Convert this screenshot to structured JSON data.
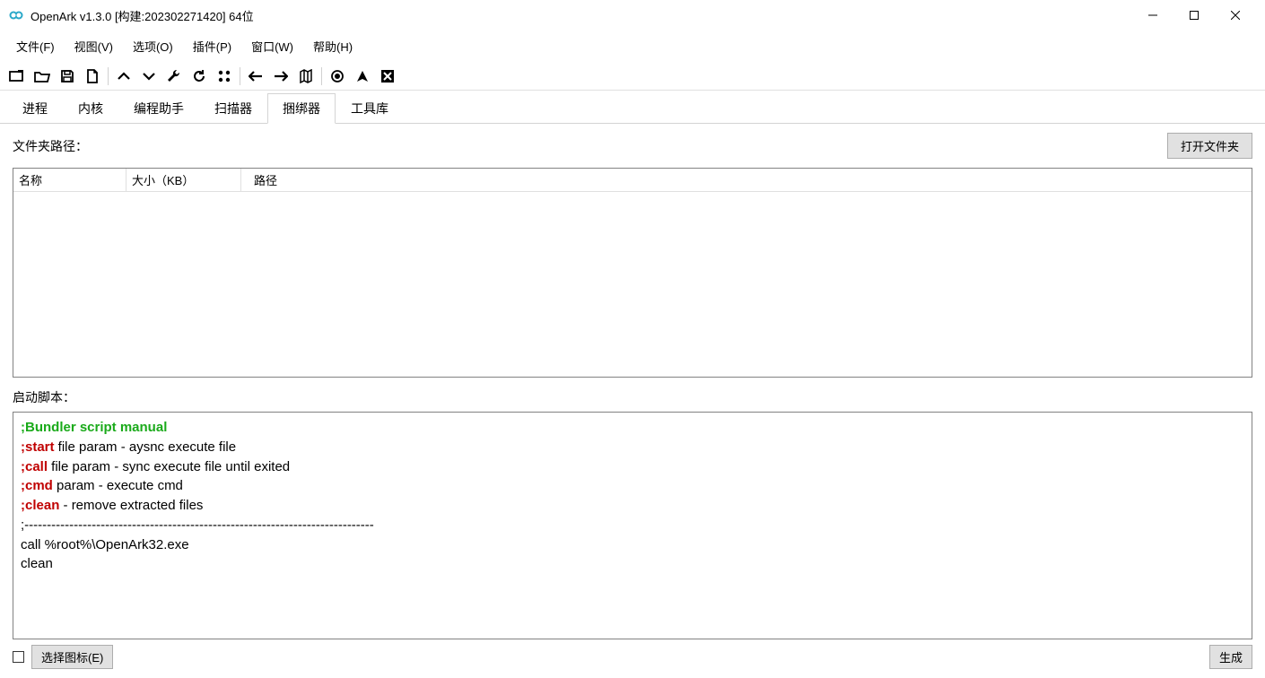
{
  "window": {
    "title": "OpenArk v1.3.0 [构建:202302271420]  64位"
  },
  "menu": {
    "file": "文件(F)",
    "view": "视图(V)",
    "options": "选项(O)",
    "plugin": "插件(P)",
    "window": "窗口(W)",
    "help": "帮助(H)"
  },
  "tabs": {
    "process": "进程",
    "kernel": "内核",
    "helper": "编程助手",
    "scanner": "扫描器",
    "bundler": "捆绑器",
    "toolkits": "工具库"
  },
  "bundler": {
    "folder_label": "文件夹路径：",
    "open_folder": "打开文件夹",
    "col_name": "名称",
    "col_size": "大小（KB）",
    "col_path": "路径",
    "script_label": "启动脚本：",
    "script": {
      "line1_comment": ";Bundler script manual",
      "line2_key": ";start",
      "line2_rest": " file param - aysnc execute file",
      "line3_key": ";call",
      "line3_rest": " file param - sync execute file until exited",
      "line4_key": ";cmd",
      "line4_rest": " param - execute cmd",
      "line5_key": ";clean",
      "line5_rest": " - remove extracted files",
      "line6": ";------------------------------------------------------------------------------",
      "line7": "call %root%\\OpenArk32.exe",
      "line8": "clean"
    },
    "select_icon": "选择图标(E)",
    "generate": "生成"
  }
}
